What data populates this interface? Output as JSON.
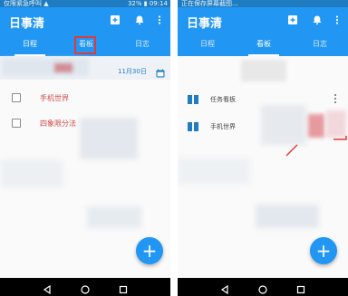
{
  "left": {
    "status": {
      "left_text": "仅限紧急呼叫 ▲",
      "right_text": "32% ▮ 09:14"
    },
    "app_title": "日事清",
    "tabs": [
      {
        "label": "日程",
        "active": true
      },
      {
        "label": "看板",
        "active": false
      },
      {
        "label": "日志",
        "active": false
      }
    ],
    "date": "11月30日",
    "tasks": [
      {
        "label": "手机世界",
        "checked": false
      },
      {
        "label": "四象限分法",
        "checked": false
      }
    ]
  },
  "right": {
    "status": {
      "left_text": "正在保存屏幕截图...",
      "right_text": ""
    },
    "app_title": "日事清",
    "tabs": [
      {
        "label": "日程",
        "active": false
      },
      {
        "label": "看板",
        "active": true
      },
      {
        "label": "日志",
        "active": false
      }
    ],
    "boards": [
      {
        "label": "任务看板"
      },
      {
        "label": "手机世界"
      }
    ]
  },
  "icons": {
    "add": "+",
    "add_board": "plus-square-icon",
    "bell": "bell-icon",
    "more": "more-vertical-icon",
    "back": "back-icon",
    "home": "home-icon",
    "recents": "recents-icon"
  },
  "colors": {
    "primary": "#2196f3",
    "status_bar": "#1f7cc1",
    "task_text": "#d04a4a",
    "highlight": "#e03b3b"
  }
}
